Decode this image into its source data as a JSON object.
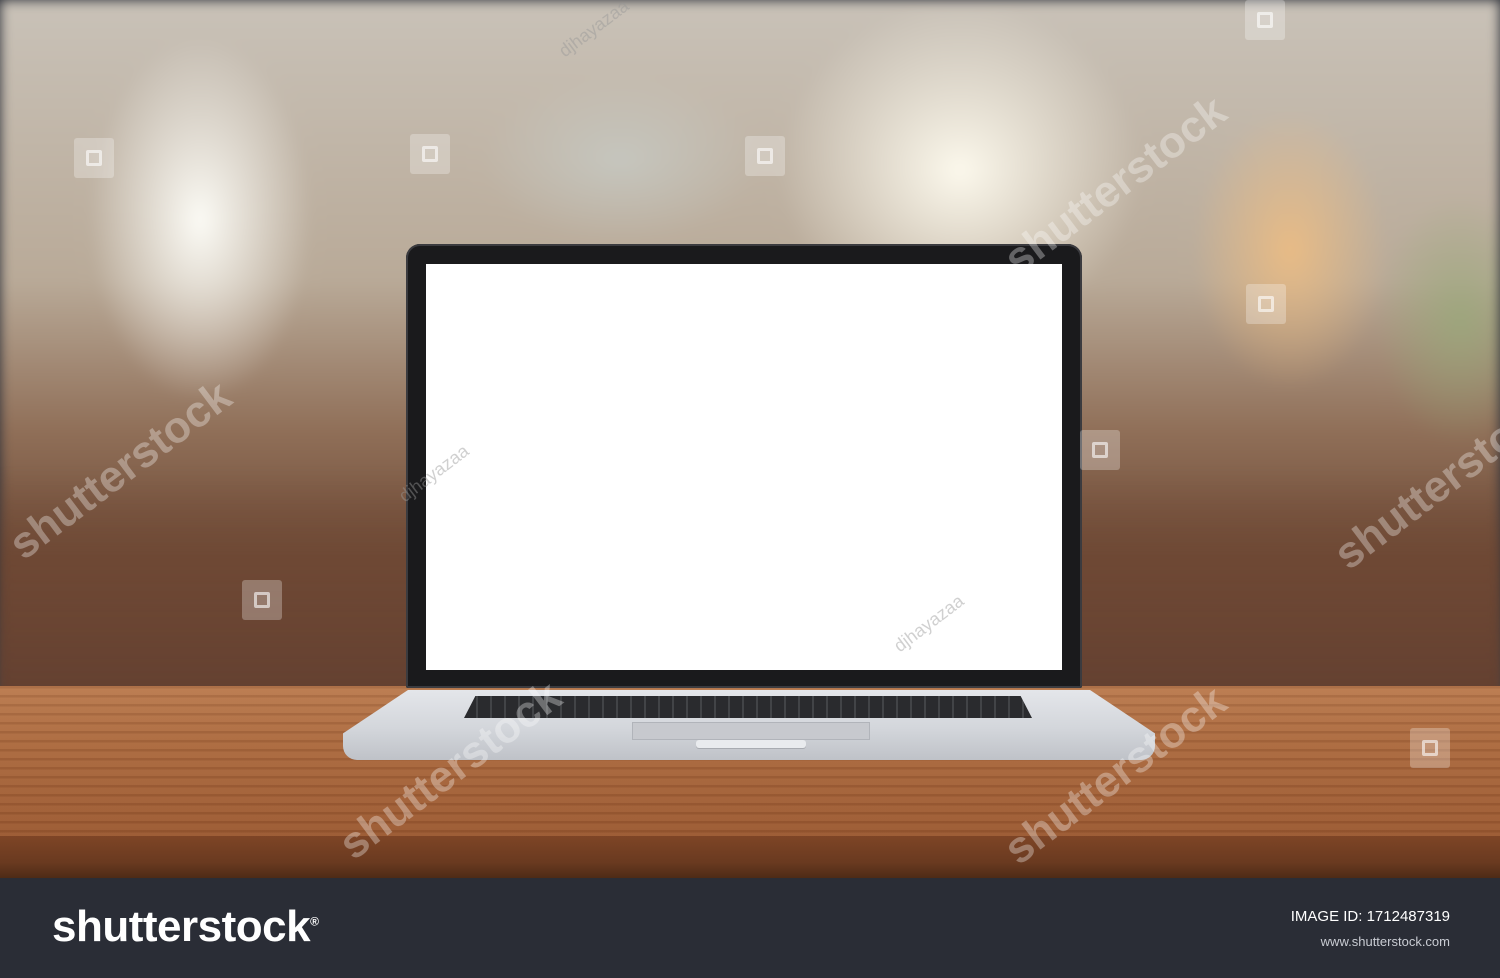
{
  "watermark": {
    "brand": "shutterstock",
    "contributor": "djhayazaa"
  },
  "footer": {
    "brand_logo": "shutterstock",
    "brand_mark": "®",
    "image_id": "IMAGE ID: 1712487319",
    "site_url": "www.shutterstock.com"
  },
  "icons": {
    "watermark_badge": "shutterstock-badge-icon"
  },
  "colors": {
    "footer_bg": "#2a2d36",
    "table_wood": "#a9683e",
    "screen": "#ffffff"
  }
}
